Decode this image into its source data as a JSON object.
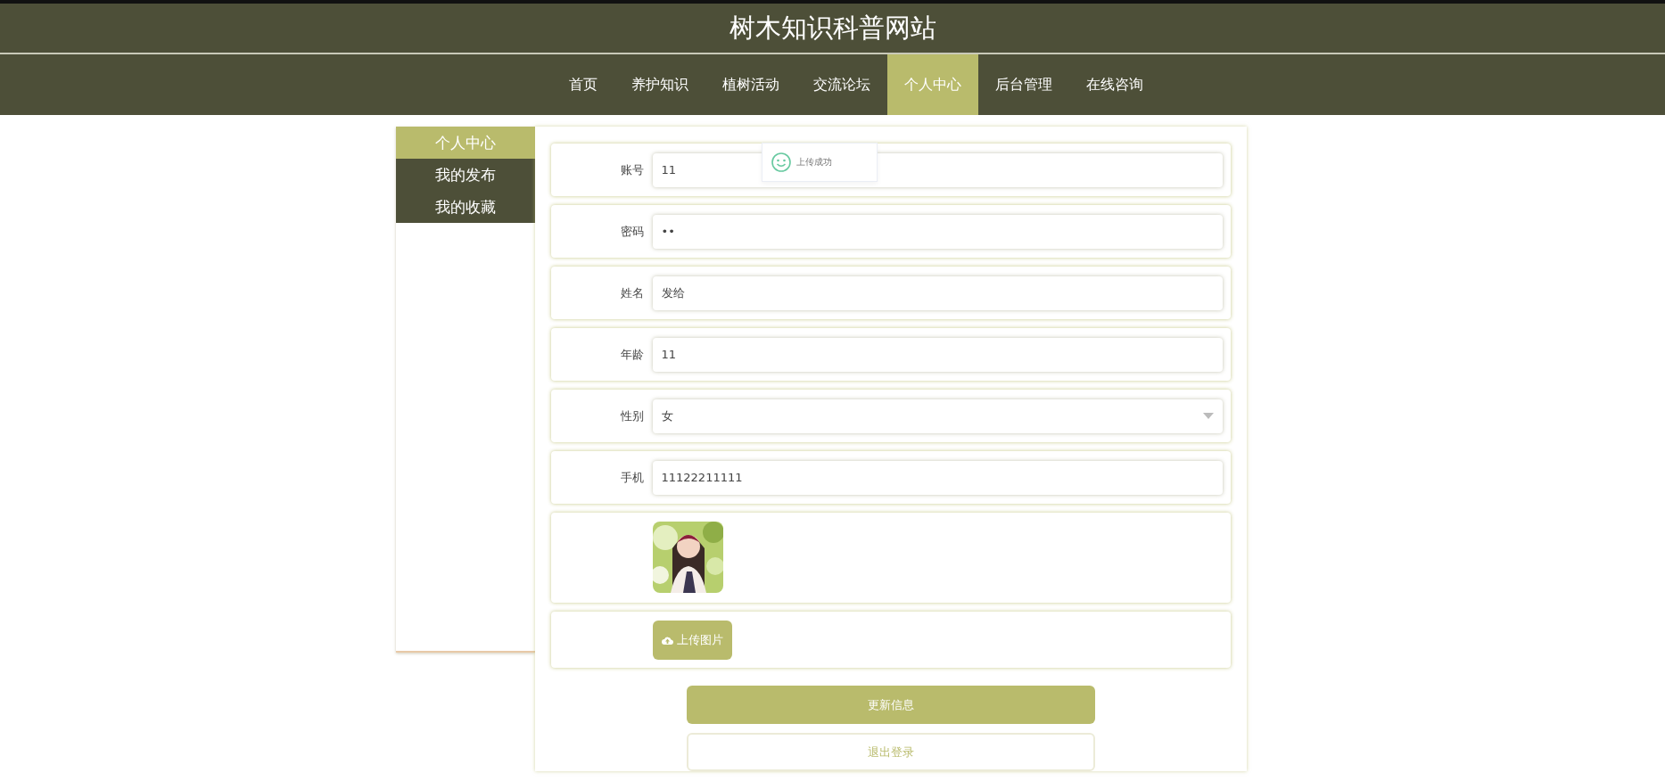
{
  "site_title": "树木知识科普网站",
  "nav": [
    {
      "label": "首页",
      "selected": false
    },
    {
      "label": "养护知识",
      "selected": false
    },
    {
      "label": "植树活动",
      "selected": false
    },
    {
      "label": "交流论坛",
      "selected": false
    },
    {
      "label": "个人中心",
      "selected": true
    },
    {
      "label": "后台管理",
      "selected": false
    },
    {
      "label": "在线咨询",
      "selected": false
    }
  ],
  "sidebar": [
    {
      "label": "个人中心",
      "selected": true
    },
    {
      "label": "我的发布",
      "selected": false
    },
    {
      "label": "我的收藏",
      "selected": false
    }
  ],
  "fields": [
    {
      "label": "账号",
      "kind": "text",
      "value": "11"
    },
    {
      "label": "密码",
      "kind": "text",
      "value": "••"
    },
    {
      "label": "姓名",
      "kind": "text",
      "value": "发给"
    },
    {
      "label": "年龄",
      "kind": "text",
      "value": "11"
    },
    {
      "label": "性别",
      "kind": "select",
      "value": "女"
    },
    {
      "label": "手机",
      "kind": "text",
      "value": "11122211111"
    }
  ],
  "upload_button": "上传图片",
  "toast": "上传成功",
  "buttons": [
    {
      "label": "更新信息",
      "kind": "primary"
    },
    {
      "label": "退出登录",
      "kind": "outline"
    }
  ]
}
